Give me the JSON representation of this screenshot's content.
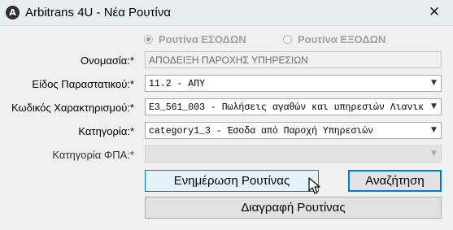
{
  "window": {
    "title": "Arbitrans 4U - Νέα Ρουτίνα",
    "icon": "app-logo-icon",
    "icon_glyph": "A",
    "close_glyph": "✕"
  },
  "routine_type": {
    "options": [
      {
        "label": "Ρουτίνα ΕΣΟΔΩΝ",
        "selected": true
      },
      {
        "label": "Ρουτίνα ΕΞΟΔΩΝ",
        "selected": false
      }
    ]
  },
  "form": {
    "name_label": "Ονομασία:*",
    "name_value": "ΑΠΟΔΕΙΞΗ ΠΑΡΟΧΗΣ ΥΠΗΡΕΣΙΩΝ",
    "doc_type_label": "Είδος Παραστατικού:*",
    "doc_type_value": "11.2 - ΑΠΥ",
    "classification_code_label": "Κωδικός Χαρακτηρισμού:*",
    "classification_code_value": "E3_561_003 - Πωλήσεις αγαθών και υπηρεσιών Λιανικ",
    "category_label": "Κατηγορία:*",
    "category_value": "category1_3 - Έσοδα από Παροχή Υπηρεσιών",
    "vat_category_label": "Κατηγορία ΦΠΑ:*",
    "vat_category_value": "",
    "dropdown_glyph": "▼"
  },
  "buttons": {
    "update_label": "Ενημέρωση Ρουτίνας",
    "search_label": "Αναζήτηση",
    "delete_label": "Διαγραφή Ρουτίνας"
  },
  "colors": {
    "titlebar": "#e8eef0",
    "accent": "#0078d7",
    "hover_fill": "#e5f1fb"
  }
}
